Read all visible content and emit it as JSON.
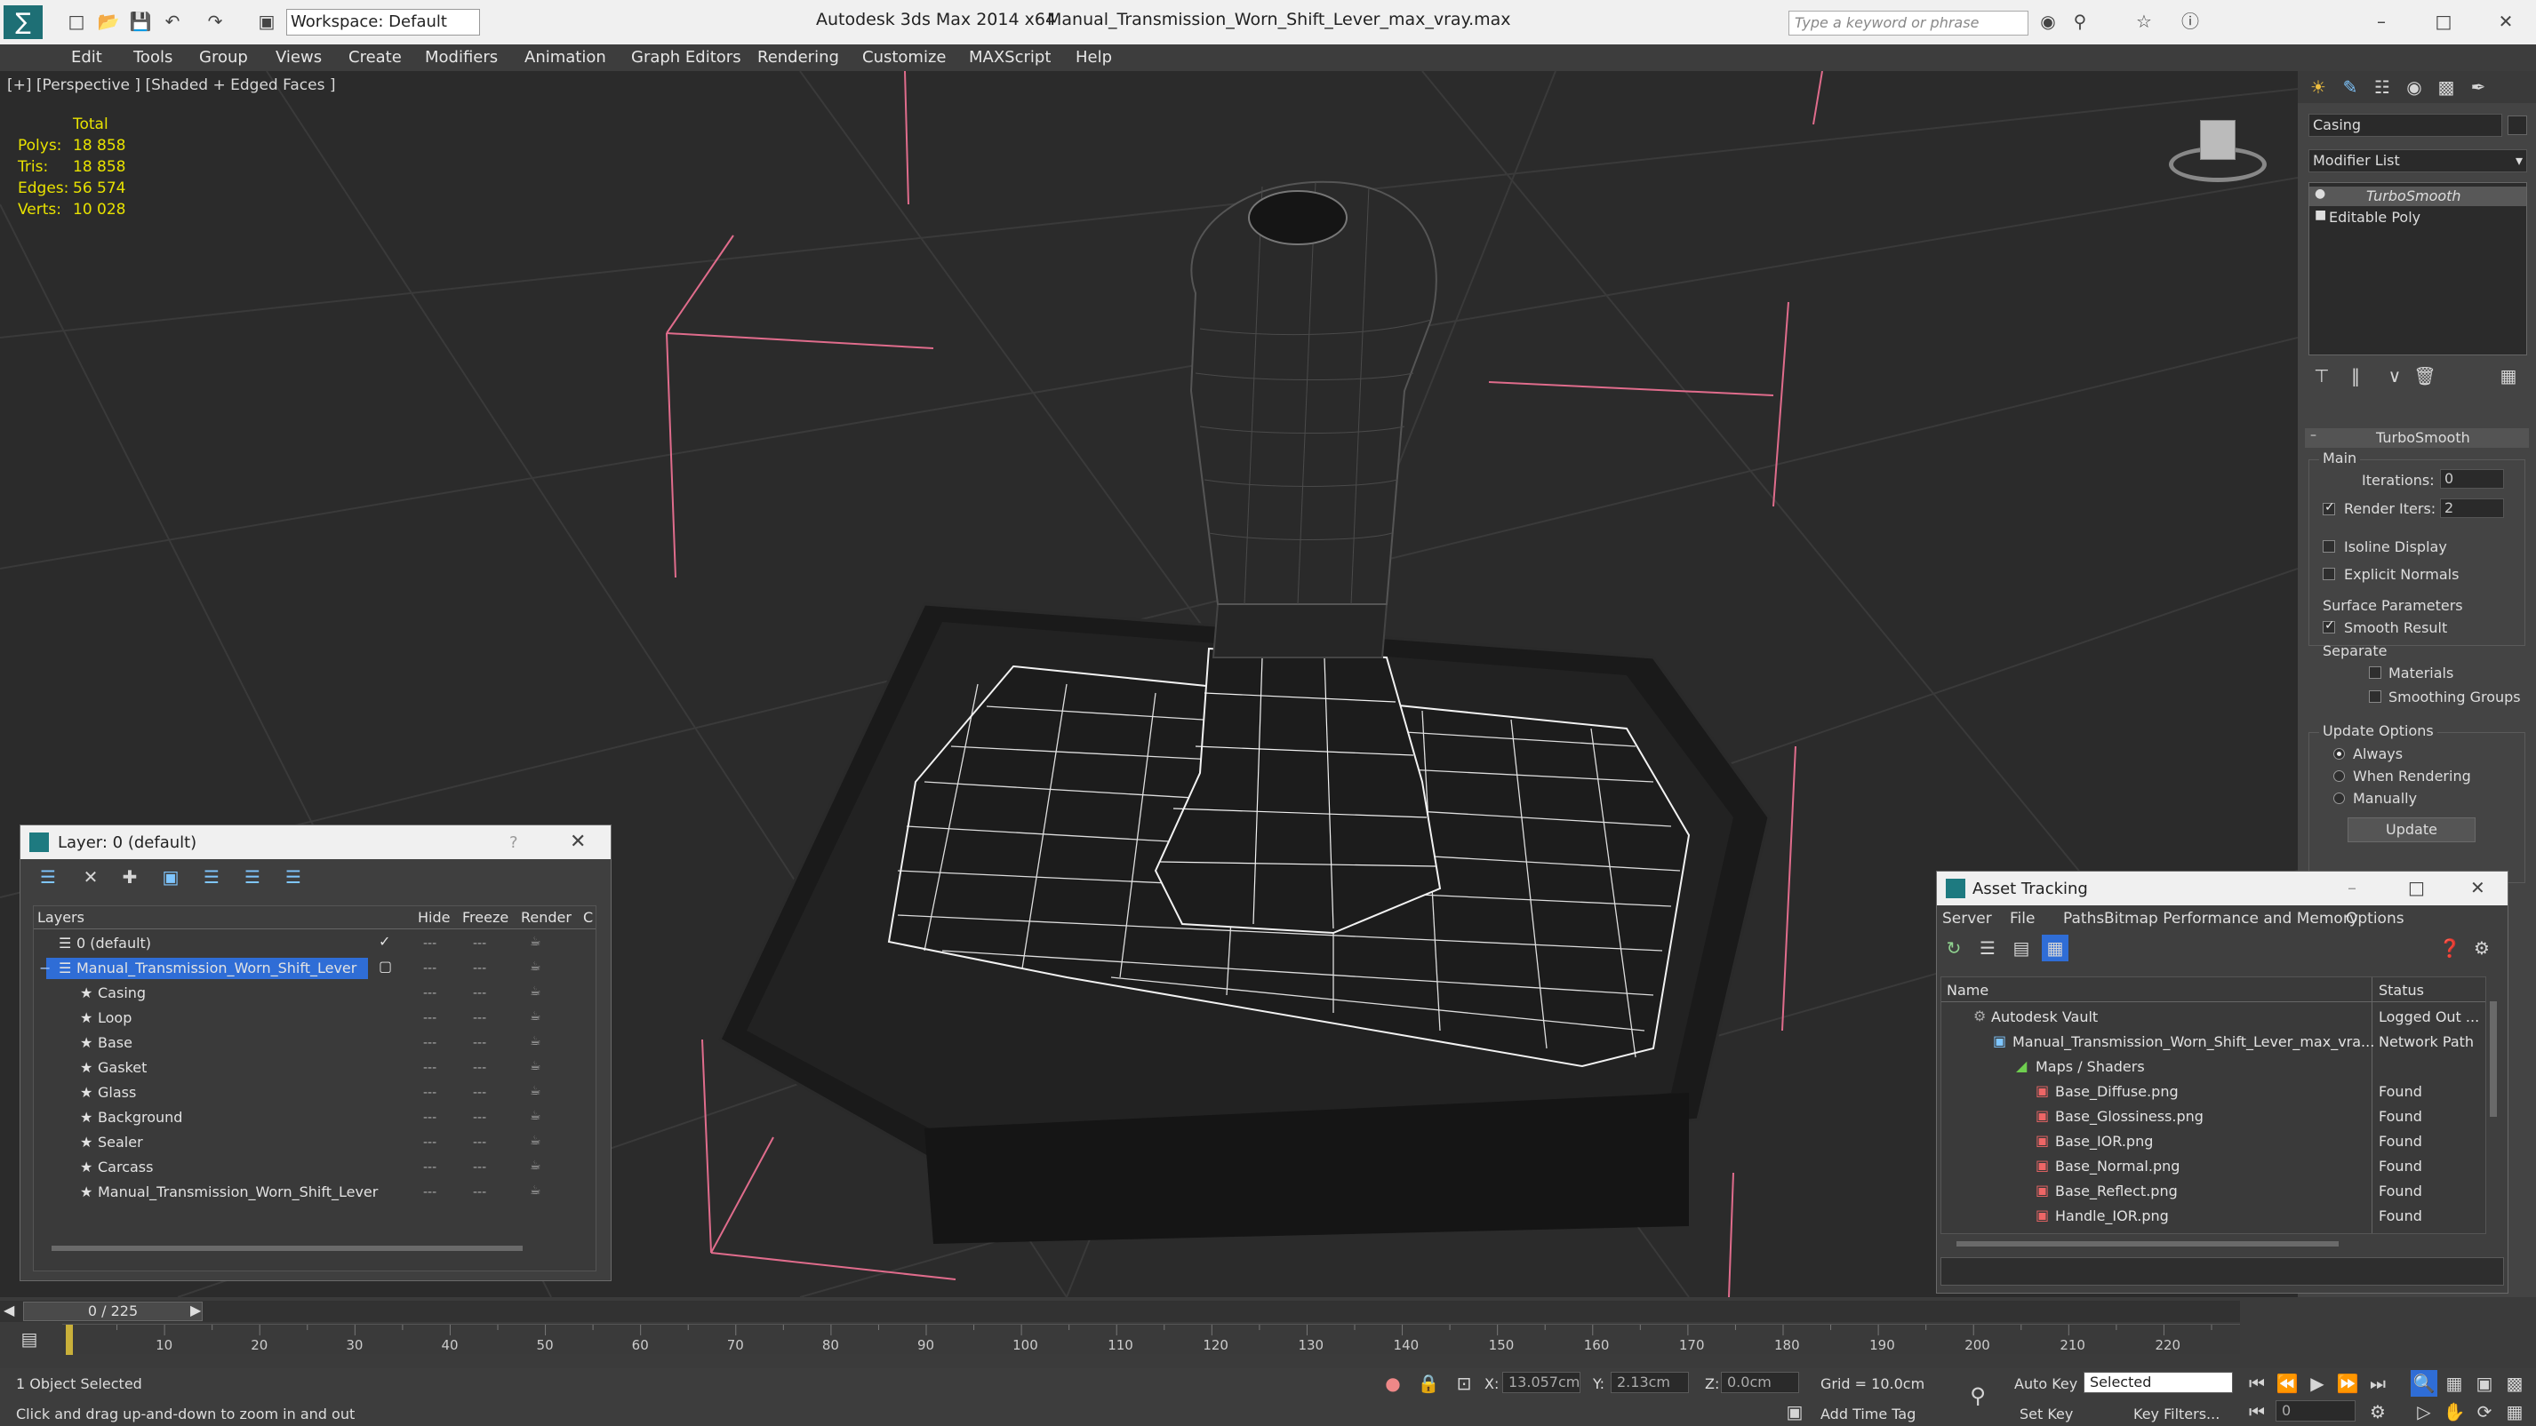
{
  "titlebar": {
    "app_title": "Autodesk 3ds Max  2014 x64",
    "file_title": "Manual_Transmission_Worn_Shift_Lever_max_vray.max",
    "workspace": "Workspace: Default",
    "search_placeholder": "Type a keyword or phrase"
  },
  "menu": [
    "Edit",
    "Tools",
    "Group",
    "Views",
    "Create",
    "Modifiers",
    "Animation",
    "Graph Editors",
    "Rendering",
    "Customize",
    "MAXScript",
    "Help"
  ],
  "viewport": {
    "label": "[+] [Perspective ] [Shaded + Edged Faces ]",
    "stats": {
      "header": "Total",
      "labels": [
        "Polys:",
        "Tris:",
        "Edges:",
        "Verts:"
      ],
      "values": [
        "18 858",
        "18 858",
        "56 574",
        "10 028"
      ]
    }
  },
  "command_panel": {
    "object_name": "Casing",
    "modifier_list": "Modifier List",
    "stack": [
      "TurboSmooth",
      "Editable Poly"
    ],
    "rollout_title": "TurboSmooth",
    "main_group": "Main",
    "iterations_label": "Iterations:",
    "iterations_value": "0",
    "render_iters_label": "Render Iters:",
    "render_iters_value": "2",
    "isoline": "Isoline Display",
    "explicit_normals": "Explicit Normals",
    "surface_group": "Surface Parameters",
    "smooth_result": "Smooth Result",
    "separate": "Separate",
    "materials": "Materials",
    "smoothing_groups": "Smoothing Groups",
    "update_group": "Update Options",
    "always": "Always",
    "when_rendering": "When Rendering",
    "manually": "Manually",
    "update_button": "Update"
  },
  "layer_window": {
    "title": "Layer: 0 (default)",
    "help": "?",
    "columns": [
      "Layers",
      "Hide",
      "Freeze",
      "Render",
      "C"
    ],
    "layers": [
      "0 (default)",
      "Manual_Transmission_Worn_Shift_Lever"
    ],
    "objects": [
      "Casing",
      "Loop",
      "Base",
      "Gasket",
      "Glass",
      "Background",
      "Sealer",
      "Carcass",
      "Manual_Transmission_Worn_Shift_Lever"
    ]
  },
  "asset_window": {
    "title": "Asset Tracking",
    "menu": [
      "Server",
      "File",
      "Paths",
      "Bitmap Performance and Memory",
      "Options"
    ],
    "columns": [
      "Name",
      "Status"
    ],
    "rows": [
      {
        "name": "Autodesk Vault",
        "status": "Logged Out ..."
      },
      {
        "name": "Manual_Transmission_Worn_Shift_Lever_max_vra...",
        "status": "Network Path"
      },
      {
        "name": "Maps / Shaders",
        "status": ""
      },
      {
        "name": "Base_Diffuse.png",
        "status": "Found"
      },
      {
        "name": "Base_Glossiness.png",
        "status": "Found"
      },
      {
        "name": "Base_IOR.png",
        "status": "Found"
      },
      {
        "name": "Base_Normal.png",
        "status": "Found"
      },
      {
        "name": "Base_Reflect.png",
        "status": "Found"
      },
      {
        "name": "Handle_IOR.png",
        "status": "Found"
      }
    ]
  },
  "timeline": {
    "frame": "0 / 225",
    "ticks": [
      "10",
      "20",
      "30",
      "40",
      "50",
      "60",
      "70",
      "80",
      "90",
      "100",
      "110",
      "120",
      "130",
      "140",
      "150",
      "160",
      "170",
      "180",
      "190",
      "200",
      "210",
      "220"
    ]
  },
  "status": {
    "selected_count": "1 Object Selected",
    "prompt": "Click and drag up-and-down to zoom in and out",
    "x_label": "X:",
    "x_value": "13.057cm",
    "y_label": "Y:",
    "y_value": "2.13cm",
    "z_label": "Z:",
    "z_value": "0.0cm",
    "grid": "Grid = 10.0cm",
    "auto_key": "Auto Key",
    "selected": "Selected",
    "set_key": "Set Key",
    "key_filters": "Key Filters...",
    "add_time_tag": "Add Time Tag",
    "current_frame": "0"
  },
  "colors": {
    "accent": "#3399ff",
    "stat_yellow": "#e8e200",
    "selection_blue": "#2f6dd6"
  }
}
